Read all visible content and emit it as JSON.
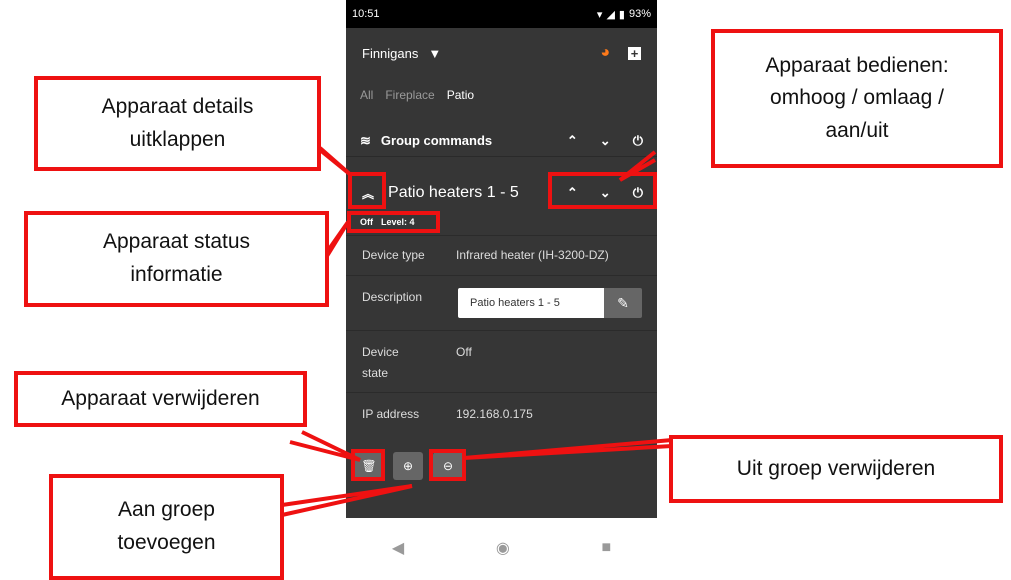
{
  "status_bar": {
    "time": "10:51",
    "battery": "93%"
  },
  "app_bar": {
    "group_name": "Finnigans",
    "dropdown_icon": "caret-down-icon",
    "logo_icon": "brand-logo-icon",
    "add_icon": "plus-box-icon"
  },
  "tabs": [
    {
      "label": "All",
      "active": false
    },
    {
      "label": "Fireplace",
      "active": false
    },
    {
      "label": "Patio",
      "active": true
    }
  ],
  "group_commands": {
    "label": "Group commands"
  },
  "device": {
    "title": "Patio heaters 1 - 5",
    "status": "Off",
    "level": "Level: 4",
    "details": {
      "device_type_label": "Device type",
      "device_type_value": "Infrared heater (IH-3200-DZ)",
      "description_label": "Description",
      "description_value": "Patio heaters 1 - 5",
      "state_label_1": "Device",
      "state_label_2": "state",
      "state_value": "Off",
      "ip_label": "IP address",
      "ip_value": "192.168.0.175"
    }
  },
  "callouts": {
    "expand_line1": "Apparaat details",
    "expand_line2": "uitklappen",
    "status_line1": "Apparaat status",
    "status_line2": "informatie",
    "delete": "Apparaat verwijderen",
    "add_line1": "Aan groep",
    "add_line2": "toevoegen",
    "control_line1": "Apparaat bedienen:",
    "control_line2": "omhoog / omlaag /",
    "control_line3": "aan/uit",
    "remove_group": "Uit groep verwijderen"
  },
  "colors": {
    "accent": "#ee1111",
    "app_bg": "#363636",
    "button_bg": "#666666"
  }
}
